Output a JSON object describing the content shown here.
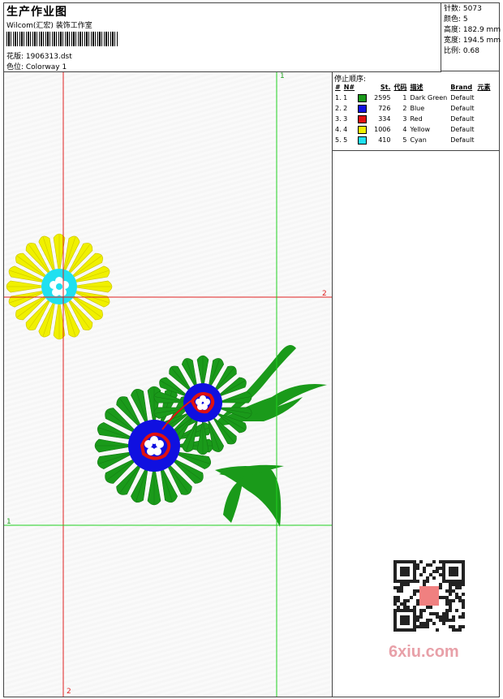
{
  "header": {
    "title": "生产作业图",
    "company": "Wilcom(汇宏) 装饰工作室",
    "design_label": "花版: 1906313.dst",
    "colorway_label": "色位: Colorway 1"
  },
  "stats": [
    {
      "label": "针数:",
      "value": "5073"
    },
    {
      "label": "颜色:",
      "value": "5"
    },
    {
      "label": "高度:",
      "value": "182.9 mm"
    },
    {
      "label": "宽度:",
      "value": "194.5 mm"
    },
    {
      "label": "比例:",
      "value": "0.68"
    }
  ],
  "stop_sequence": {
    "title": "停止顺序:",
    "headers": [
      "#",
      "N#",
      "St.",
      "代码",
      "描述",
      "Brand",
      "元素"
    ],
    "rows": [
      {
        "idx": "1. 1",
        "color": "#1a9a1a",
        "stitches": "2595",
        "code": "1",
        "desc": "Dark Green",
        "brand": "Default"
      },
      {
        "idx": "2. 2",
        "color": "#1010e0",
        "stitches": "726",
        "code": "2",
        "desc": "Blue",
        "brand": "Default"
      },
      {
        "idx": "3. 3",
        "color": "#e01010",
        "stitches": "334",
        "code": "3",
        "desc": "Red",
        "brand": "Default"
      },
      {
        "idx": "4. 4",
        "color": "#f0f000",
        "stitches": "1006",
        "code": "4",
        "desc": "Yellow",
        "brand": "Default"
      },
      {
        "idx": "5. 5",
        "color": "#20e0f0",
        "stitches": "410",
        "code": "5",
        "desc": "Cyan",
        "brand": "Default"
      }
    ]
  },
  "guides": {
    "green_v_label": "1",
    "red_h_label": "2",
    "green_h_label": "1",
    "red_v_label": "2"
  },
  "watermark": "6xiu.com",
  "colors": {
    "green": "#1a9a1a",
    "blue": "#1010e0",
    "red": "#e01010",
    "yellow": "#f0f000",
    "cyan": "#20e0f0",
    "guide_red": "#e02020",
    "guide_green": "#20d020"
  }
}
